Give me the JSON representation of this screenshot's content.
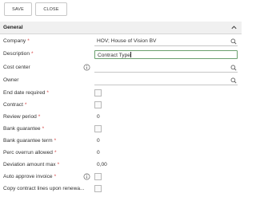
{
  "toolbar": {
    "save_label": "SAVE",
    "close_label": "CLOSE"
  },
  "section": {
    "title": "General"
  },
  "fields": {
    "company": {
      "label": "Company",
      "value": "HOV; House of Vision BV"
    },
    "description": {
      "label": "Description",
      "value": "Contract Type"
    },
    "cost_center": {
      "label": "Cost center",
      "value": ""
    },
    "owner": {
      "label": "Owner",
      "value": ""
    },
    "end_date_required": {
      "label": "End date required"
    },
    "contract": {
      "label": "Contract"
    },
    "review_period": {
      "label": "Review period",
      "value": "0"
    },
    "bank_guarantee": {
      "label": "Bank guarantee"
    },
    "bank_guarantee_term": {
      "label": "Bank guarantee term",
      "value": "0"
    },
    "perc_overrun_allowed": {
      "label": "Perc overrun allowed",
      "value": "0"
    },
    "deviation_amount_max": {
      "label": "Deviation amount max",
      "value": "0,00"
    },
    "auto_approve_invoice": {
      "label": "Auto approve invoice"
    },
    "copy_contract_lines": {
      "label": "Copy contract lines upon renewa..."
    }
  },
  "required_marker": "*",
  "colors": {
    "required": "#d64545",
    "focus_border": "#6aa06e",
    "section_bg": "#f0f0f0"
  },
  "icons": {
    "search": "search-icon",
    "info": "info-icon",
    "collapse": "chevron-up-icon"
  }
}
